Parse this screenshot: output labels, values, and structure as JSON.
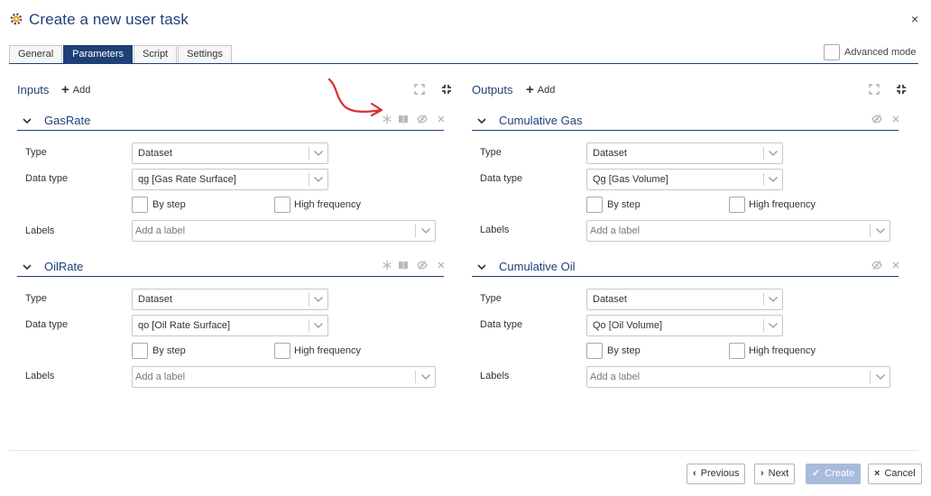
{
  "dialog": {
    "title": "Create a new user task",
    "close_glyph": "×"
  },
  "tabs": [
    {
      "label": "General",
      "active": false
    },
    {
      "label": "Parameters",
      "active": true
    },
    {
      "label": "Script",
      "active": false
    },
    {
      "label": "Settings",
      "active": false
    }
  ],
  "advanced_mode": {
    "label": "Advanced mode",
    "checked": false
  },
  "inputs": {
    "title": "Inputs",
    "add_label": "Add",
    "params": [
      {
        "name": "GasRate",
        "type_label": "Type",
        "type_value": "Dataset",
        "datatype_label": "Data type",
        "datatype_value": "qg [Gas Rate Surface]",
        "by_step_label": "By step",
        "high_freq_label": "High frequency",
        "labels_label": "Labels",
        "labels_placeholder": "Add a label"
      },
      {
        "name": "OilRate",
        "type_label": "Type",
        "type_value": "Dataset",
        "datatype_label": "Data type",
        "datatype_value": "qo [Oil Rate Surface]",
        "by_step_label": "By step",
        "high_freq_label": "High frequency",
        "labels_label": "Labels",
        "labels_placeholder": "Add a label"
      }
    ]
  },
  "outputs": {
    "title": "Outputs",
    "add_label": "Add",
    "params": [
      {
        "name": "Cumulative Gas",
        "type_label": "Type",
        "type_value": "Dataset",
        "datatype_label": "Data type",
        "datatype_value": "Qg [Gas Volume]",
        "by_step_label": "By step",
        "high_freq_label": "High frequency",
        "labels_label": "Labels",
        "labels_placeholder": "Add a label"
      },
      {
        "name": "Cumulative Oil",
        "type_label": "Type",
        "type_value": "Dataset",
        "datatype_label": "Data type",
        "datatype_value": "Qo [Oil Volume]",
        "by_step_label": "By step",
        "high_freq_label": "High frequency",
        "labels_label": "Labels",
        "labels_placeholder": "Add a label"
      }
    ]
  },
  "footer": {
    "previous": "Previous",
    "next": "Next",
    "create": "Create",
    "cancel": "Cancel"
  },
  "colors": {
    "accent": "#1f3f77",
    "annotation_arrow": "#d9302f",
    "disabled_primary": "#a9bbdb"
  }
}
